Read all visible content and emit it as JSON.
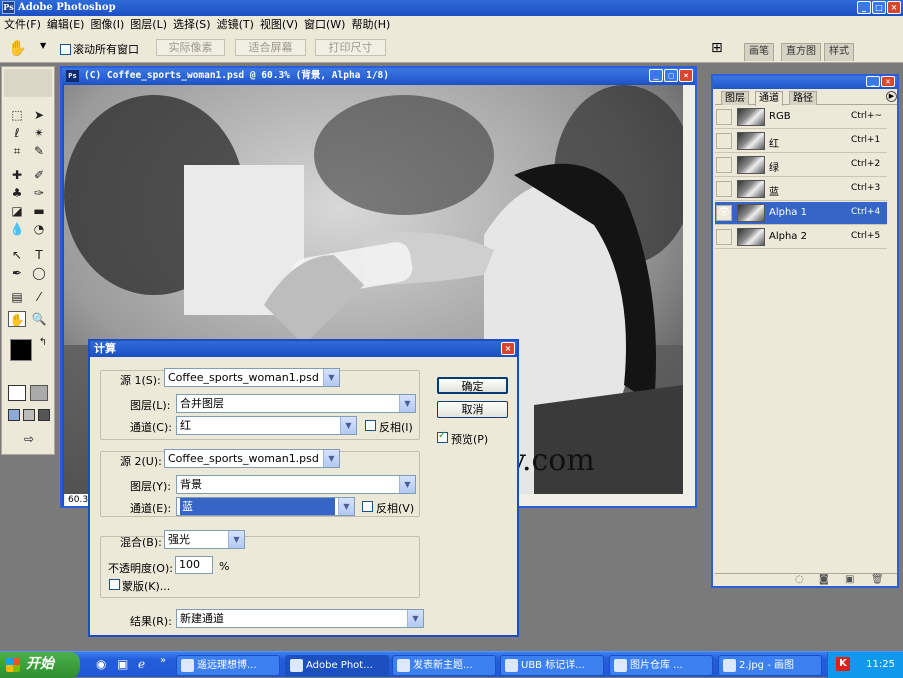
{
  "app": {
    "title": "Adobe Photoshop"
  },
  "menu": [
    "文件(F)",
    "编辑(E)",
    "图像(I)",
    "图层(L)",
    "选择(S)",
    "滤镜(T)",
    "视图(V)",
    "窗口(W)",
    "帮助(H)"
  ],
  "options": {
    "scroll_all": "滚动所有窗口",
    "actual_pixels": "实际像素",
    "fit_screen": "适合屏幕",
    "print_size": "打印尺寸",
    "palette_tabs": [
      "画笔",
      "直方图",
      "样式"
    ]
  },
  "document": {
    "title": "(C) Coffee_sports_woman1.psd @ 60.3% (背景, Alpha 1/8)",
    "zoom": "60.31",
    "watermark": "y.com"
  },
  "channels_panel": {
    "tabs": [
      "图层",
      "通道",
      "路径"
    ],
    "rows": [
      {
        "name": "RGB",
        "shortcut": "Ctrl+~"
      },
      {
        "name": "红",
        "shortcut": "Ctrl+1"
      },
      {
        "name": "绿",
        "shortcut": "Ctrl+2"
      },
      {
        "name": "蓝",
        "shortcut": "Ctrl+3"
      },
      {
        "name": "Alpha 1",
        "shortcut": "Ctrl+4"
      },
      {
        "name": "Alpha 2",
        "shortcut": "Ctrl+5"
      }
    ],
    "selected_index": 4
  },
  "calc_dialog": {
    "title": "计算",
    "source1_label": "源 1(S):",
    "source1_value": "Coffee_sports_woman1.psd",
    "layer1_label": "图层(L):",
    "layer1_value": "合并图层",
    "channel1_label": "通道(C):",
    "channel1_value": "红",
    "invert1_label": "反相(I)",
    "source2_label": "源 2(U):",
    "source2_value": "Coffee_sports_woman1.psd",
    "layer2_label": "图层(Y):",
    "layer2_value": "背景",
    "channel2_label": "通道(E):",
    "channel2_value": "蓝",
    "invert2_label": "反相(V)",
    "blend_label": "混合(B):",
    "blend_value": "强光",
    "opacity_label": "不透明度(O):",
    "opacity_value": "100",
    "opacity_unit": "%",
    "mask_label": "蒙版(K)...",
    "result_label": "结果(R):",
    "result_value": "新建通道",
    "ok": "确定",
    "cancel": "取消",
    "preview": "预览(P)"
  },
  "taskbar": {
    "start": "开始",
    "items": [
      "遥远理想博...",
      "Adobe Phot...",
      "发表新主题...",
      "UBB 标记详...",
      "图片仓库 ...",
      "2.jpg - 画图"
    ],
    "time": "11:25"
  }
}
